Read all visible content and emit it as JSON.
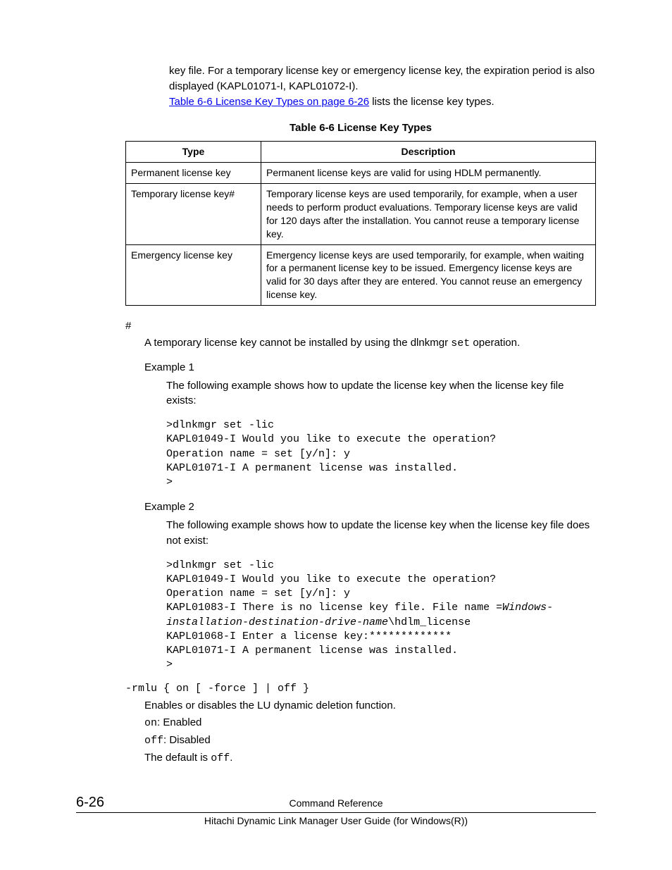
{
  "intro": {
    "line1": "key file. For a temporary license key or emergency license key, the expiration period is also displayed (KAPL01071-I, KAPL01072-I).",
    "link": "Table 6-6 License Key Types on page 6-26",
    "line2_rest": " lists the license key types."
  },
  "table": {
    "title": "Table 6-6 License Key Types",
    "headers": [
      "Type",
      "Description"
    ],
    "rows": [
      {
        "type": "Permanent license key",
        "desc": "Permanent license keys are valid for using HDLM permanently."
      },
      {
        "type": "Temporary license key#",
        "desc": "Temporary license keys are used temporarily, for example, when a user needs to perform product evaluations. Temporary license keys are valid for 120 days after the installation. You cannot reuse a temporary license key."
      },
      {
        "type": "Emergency license key",
        "desc": "Emergency license keys are used temporarily, for example, when waiting for a permanent license key to be issued. Emergency license keys are valid for 30 days after they are entered. You cannot reuse an emergency license key."
      }
    ]
  },
  "hash": {
    "mark": "#",
    "text_pre": "A temporary license key cannot be installed by using the dlnkmgr ",
    "code": "set",
    "text_post": " operation."
  },
  "example1": {
    "title": "Example 1",
    "desc": "The following example shows how to update the license key when the license key file exists:",
    "code": ">dlnkmgr set -lic\nKAPL01049-I Would you like to execute the operation?\nOperation name = set [y/n]: y\nKAPL01071-I A permanent license was installed.\n>"
  },
  "example2": {
    "title": "Example 2",
    "desc": "The following example shows how to update the license key when the license key file does not exist:",
    "code_l1": ">dlnkmgr set -lic",
    "code_l2": "KAPL01049-I Would you like to execute the operation?",
    "code_l3": "Operation name = set [y/n]: y",
    "code_l4a": "KAPL01083-I There is no license key file. File name =",
    "code_l4b": "Windows-",
    "code_l5a": "installation-destination-drive-name",
    "code_l5b": "\\hdlm_license",
    "code_l6": "KAPL01068-I Enter a license key:*************",
    "code_l7": "KAPL01071-I A permanent license was installed.",
    "code_l8": ">"
  },
  "option": {
    "syntax": "-rmlu { on [ -force ] | off }",
    "desc": "Enables or disables the LU dynamic deletion function.",
    "on_code": "on",
    "on_text": ": Enabled",
    "off_code": "off",
    "off_text": ": Disabled",
    "default_pre": "The default is ",
    "default_code": "off",
    "default_post": "."
  },
  "footer": {
    "page": "6-26",
    "section": "Command Reference",
    "guide": "Hitachi Dynamic Link Manager User Guide (for Windows(R))"
  }
}
